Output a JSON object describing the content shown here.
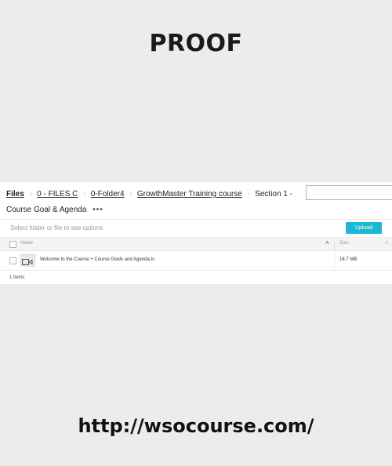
{
  "overlay": {
    "title": "PROOF",
    "footer_url": "http://wsocourse.com/"
  },
  "breadcrumb": {
    "items": [
      "Files",
      "0 - FILES C",
      "0-Folder4",
      "GrowthMaster Training course"
    ],
    "current": "Section 1 -",
    "current_line2": "Course Goal & Agenda",
    "more": "•••"
  },
  "toolbar": {
    "hint": "Select folder or file to see options",
    "upload_label": "Upload",
    "accent_color": "#19b9d3"
  },
  "list": {
    "columns": [
      "Name",
      "Size"
    ],
    "sort_icon": "chevron-up-icon",
    "rows": [
      {
        "icon": "video-file-icon",
        "name": "Welcome to the Course + Course Goals and Agenda.ts",
        "size": "16.7 MB"
      }
    ],
    "count_label": "1 items"
  }
}
